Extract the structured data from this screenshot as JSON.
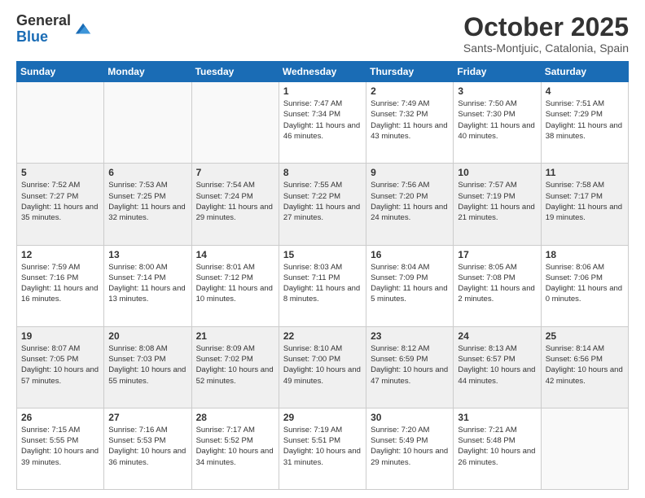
{
  "logo": {
    "general": "General",
    "blue": "Blue"
  },
  "header": {
    "month": "October 2025",
    "location": "Sants-Montjuic, Catalonia, Spain"
  },
  "weekdays": [
    "Sunday",
    "Monday",
    "Tuesday",
    "Wednesday",
    "Thursday",
    "Friday",
    "Saturday"
  ],
  "weeks": [
    [
      {
        "day": "",
        "sunrise": "",
        "sunset": "",
        "daylight": ""
      },
      {
        "day": "",
        "sunrise": "",
        "sunset": "",
        "daylight": ""
      },
      {
        "day": "",
        "sunrise": "",
        "sunset": "",
        "daylight": ""
      },
      {
        "day": "1",
        "sunrise": "Sunrise: 7:47 AM",
        "sunset": "Sunset: 7:34 PM",
        "daylight": "Daylight: 11 hours and 46 minutes."
      },
      {
        "day": "2",
        "sunrise": "Sunrise: 7:49 AM",
        "sunset": "Sunset: 7:32 PM",
        "daylight": "Daylight: 11 hours and 43 minutes."
      },
      {
        "day": "3",
        "sunrise": "Sunrise: 7:50 AM",
        "sunset": "Sunset: 7:30 PM",
        "daylight": "Daylight: 11 hours and 40 minutes."
      },
      {
        "day": "4",
        "sunrise": "Sunrise: 7:51 AM",
        "sunset": "Sunset: 7:29 PM",
        "daylight": "Daylight: 11 hours and 38 minutes."
      }
    ],
    [
      {
        "day": "5",
        "sunrise": "Sunrise: 7:52 AM",
        "sunset": "Sunset: 7:27 PM",
        "daylight": "Daylight: 11 hours and 35 minutes."
      },
      {
        "day": "6",
        "sunrise": "Sunrise: 7:53 AM",
        "sunset": "Sunset: 7:25 PM",
        "daylight": "Daylight: 11 hours and 32 minutes."
      },
      {
        "day": "7",
        "sunrise": "Sunrise: 7:54 AM",
        "sunset": "Sunset: 7:24 PM",
        "daylight": "Daylight: 11 hours and 29 minutes."
      },
      {
        "day": "8",
        "sunrise": "Sunrise: 7:55 AM",
        "sunset": "Sunset: 7:22 PM",
        "daylight": "Daylight: 11 hours and 27 minutes."
      },
      {
        "day": "9",
        "sunrise": "Sunrise: 7:56 AM",
        "sunset": "Sunset: 7:20 PM",
        "daylight": "Daylight: 11 hours and 24 minutes."
      },
      {
        "day": "10",
        "sunrise": "Sunrise: 7:57 AM",
        "sunset": "Sunset: 7:19 PM",
        "daylight": "Daylight: 11 hours and 21 minutes."
      },
      {
        "day": "11",
        "sunrise": "Sunrise: 7:58 AM",
        "sunset": "Sunset: 7:17 PM",
        "daylight": "Daylight: 11 hours and 19 minutes."
      }
    ],
    [
      {
        "day": "12",
        "sunrise": "Sunrise: 7:59 AM",
        "sunset": "Sunset: 7:16 PM",
        "daylight": "Daylight: 11 hours and 16 minutes."
      },
      {
        "day": "13",
        "sunrise": "Sunrise: 8:00 AM",
        "sunset": "Sunset: 7:14 PM",
        "daylight": "Daylight: 11 hours and 13 minutes."
      },
      {
        "day": "14",
        "sunrise": "Sunrise: 8:01 AM",
        "sunset": "Sunset: 7:12 PM",
        "daylight": "Daylight: 11 hours and 10 minutes."
      },
      {
        "day": "15",
        "sunrise": "Sunrise: 8:03 AM",
        "sunset": "Sunset: 7:11 PM",
        "daylight": "Daylight: 11 hours and 8 minutes."
      },
      {
        "day": "16",
        "sunrise": "Sunrise: 8:04 AM",
        "sunset": "Sunset: 7:09 PM",
        "daylight": "Daylight: 11 hours and 5 minutes."
      },
      {
        "day": "17",
        "sunrise": "Sunrise: 8:05 AM",
        "sunset": "Sunset: 7:08 PM",
        "daylight": "Daylight: 11 hours and 2 minutes."
      },
      {
        "day": "18",
        "sunrise": "Sunrise: 8:06 AM",
        "sunset": "Sunset: 7:06 PM",
        "daylight": "Daylight: 11 hours and 0 minutes."
      }
    ],
    [
      {
        "day": "19",
        "sunrise": "Sunrise: 8:07 AM",
        "sunset": "Sunset: 7:05 PM",
        "daylight": "Daylight: 10 hours and 57 minutes."
      },
      {
        "day": "20",
        "sunrise": "Sunrise: 8:08 AM",
        "sunset": "Sunset: 7:03 PM",
        "daylight": "Daylight: 10 hours and 55 minutes."
      },
      {
        "day": "21",
        "sunrise": "Sunrise: 8:09 AM",
        "sunset": "Sunset: 7:02 PM",
        "daylight": "Daylight: 10 hours and 52 minutes."
      },
      {
        "day": "22",
        "sunrise": "Sunrise: 8:10 AM",
        "sunset": "Sunset: 7:00 PM",
        "daylight": "Daylight: 10 hours and 49 minutes."
      },
      {
        "day": "23",
        "sunrise": "Sunrise: 8:12 AM",
        "sunset": "Sunset: 6:59 PM",
        "daylight": "Daylight: 10 hours and 47 minutes."
      },
      {
        "day": "24",
        "sunrise": "Sunrise: 8:13 AM",
        "sunset": "Sunset: 6:57 PM",
        "daylight": "Daylight: 10 hours and 44 minutes."
      },
      {
        "day": "25",
        "sunrise": "Sunrise: 8:14 AM",
        "sunset": "Sunset: 6:56 PM",
        "daylight": "Daylight: 10 hours and 42 minutes."
      }
    ],
    [
      {
        "day": "26",
        "sunrise": "Sunrise: 7:15 AM",
        "sunset": "Sunset: 5:55 PM",
        "daylight": "Daylight: 10 hours and 39 minutes."
      },
      {
        "day": "27",
        "sunrise": "Sunrise: 7:16 AM",
        "sunset": "Sunset: 5:53 PM",
        "daylight": "Daylight: 10 hours and 36 minutes."
      },
      {
        "day": "28",
        "sunrise": "Sunrise: 7:17 AM",
        "sunset": "Sunset: 5:52 PM",
        "daylight": "Daylight: 10 hours and 34 minutes."
      },
      {
        "day": "29",
        "sunrise": "Sunrise: 7:19 AM",
        "sunset": "Sunset: 5:51 PM",
        "daylight": "Daylight: 10 hours and 31 minutes."
      },
      {
        "day": "30",
        "sunrise": "Sunrise: 7:20 AM",
        "sunset": "Sunset: 5:49 PM",
        "daylight": "Daylight: 10 hours and 29 minutes."
      },
      {
        "day": "31",
        "sunrise": "Sunrise: 7:21 AM",
        "sunset": "Sunset: 5:48 PM",
        "daylight": "Daylight: 10 hours and 26 minutes."
      },
      {
        "day": "",
        "sunrise": "",
        "sunset": "",
        "daylight": ""
      }
    ]
  ]
}
